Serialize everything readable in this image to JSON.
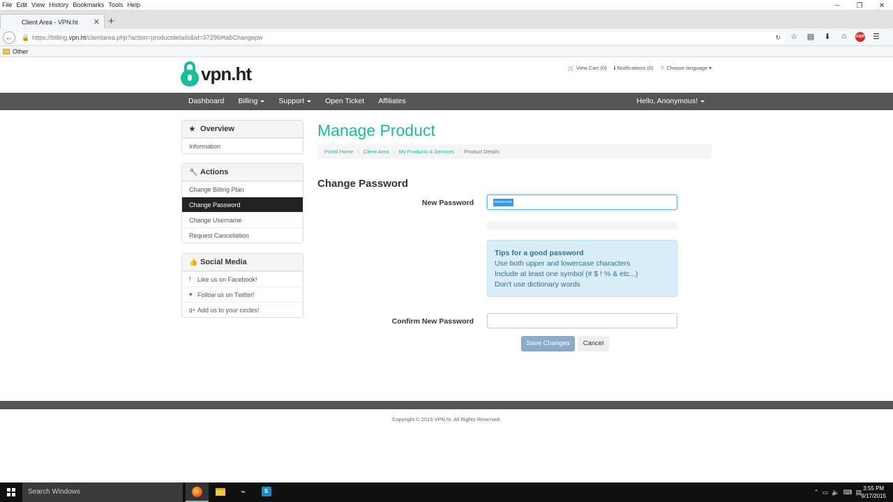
{
  "browser": {
    "menu": [
      "File",
      "Edit",
      "View",
      "History",
      "Bookmarks",
      "Tools",
      "Help"
    ],
    "tab_title": "Client Area - VPN.ht",
    "url_prefix": "https://billing.",
    "url_domain": "vpn.ht",
    "url_path": "/clientarea.php?action=productdetails&id=97296#tabChangepw",
    "bookmark_folder": "Other"
  },
  "site": {
    "logo_text": "vpn.ht",
    "top_links": {
      "cart": "View Cart (0)",
      "notifications": "Notifications (0)",
      "language": "Choose language"
    },
    "nav": {
      "dashboard": "Dashboard",
      "billing": "Billing",
      "support": "Support",
      "open_ticket": "Open Ticket",
      "affiliates": "Affiliates",
      "user": "Hello, Anonymous!"
    }
  },
  "sidebar": {
    "overview": {
      "title": "Overview",
      "items": [
        "Information"
      ]
    },
    "actions": {
      "title": "Actions",
      "items": [
        "Change Billing Plan",
        "Change Password",
        "Change Username",
        "Request Cancellation"
      ],
      "active_index": 1
    },
    "social": {
      "title": "Social Media",
      "items": [
        "Like us on Facebook!",
        "Follow us on Twitter!",
        "Add us to your circles!"
      ]
    }
  },
  "main": {
    "page_title": "Manage Product",
    "breadcrumb": [
      "Portal Home",
      "Client Area",
      "My Products & Services",
      "Product Details"
    ],
    "section_title": "Change Password",
    "new_password_label": "New Password",
    "new_password_value": "•••••••••",
    "tips": {
      "title": "Tips for a good password",
      "lines": [
        "Use both upper and lowercase characters",
        "Include at least one symbol (# $ ! % & etc...)",
        "Don't use dictionary words"
      ]
    },
    "confirm_label": "Confirm New Password",
    "confirm_value": "",
    "save_label": "Save Changes",
    "cancel_label": "Cancel"
  },
  "footer": {
    "copyright": "Copyright © 2015 VPN.ht. All Rights Reserved."
  },
  "taskbar": {
    "search_placeholder": "Search Windows",
    "time": "3:55 PM",
    "date": "9/17/2015"
  },
  "colors": {
    "brand": "#1abc9c",
    "nav_bg": "#555555",
    "active_item": "#222222",
    "info_bg": "#d9edf7"
  }
}
